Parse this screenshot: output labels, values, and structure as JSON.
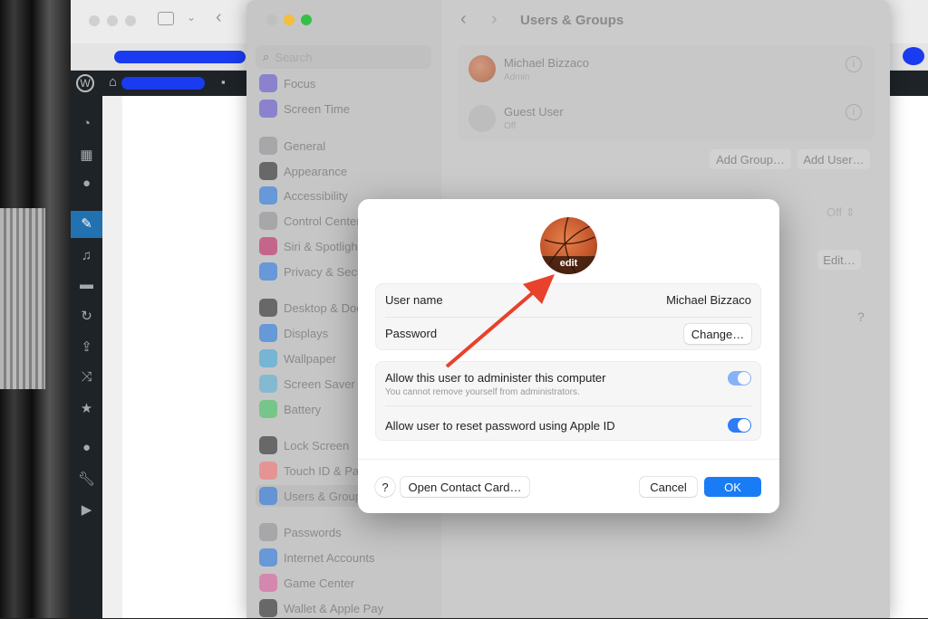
{
  "browser": {
    "accent": "#2271b1"
  },
  "settings": {
    "search_placeholder": "Search",
    "title": "Users & Groups",
    "sidebar": [
      {
        "label": "Focus",
        "color": "#5b4bd6"
      },
      {
        "label": "Screen Time",
        "color": "#5b4bd6"
      },
      {
        "label": "General",
        "color": "#8e8e93"
      },
      {
        "label": "Appearance",
        "color": "#1c1c1e"
      },
      {
        "label": "Accessibility",
        "color": "#1a73e8"
      },
      {
        "label": "Control Center",
        "color": "#8e8e93"
      },
      {
        "label": "Siri & Spotlight",
        "color": "#c2185b"
      },
      {
        "label": "Privacy & Security",
        "color": "#1a73e8"
      },
      {
        "label": "Desktop & Dock",
        "color": "#1c1c1e"
      },
      {
        "label": "Displays",
        "color": "#1a73e8"
      },
      {
        "label": "Wallpaper",
        "color": "#35a7e0"
      },
      {
        "label": "Screen Saver",
        "color": "#4fb0d8"
      },
      {
        "label": "Battery",
        "color": "#34c759"
      },
      {
        "label": "Lock Screen",
        "color": "#1c1c1e"
      },
      {
        "label": "Touch ID & Password",
        "color": "#ff6b6b"
      },
      {
        "label": "Users & Groups",
        "color": "#1a73e8",
        "selected": true
      },
      {
        "label": "Passwords",
        "color": "#8e8e93"
      },
      {
        "label": "Internet Accounts",
        "color": "#1a73e8"
      },
      {
        "label": "Game Center",
        "color": "#e0559a"
      },
      {
        "label": "Wallet & Apple Pay",
        "color": "#1c1c1e"
      }
    ],
    "users": [
      {
        "name": "Michael Bizzaco",
        "role": "Admin"
      },
      {
        "name": "Guest User",
        "role": "Off"
      }
    ],
    "add_group": "Add Group…",
    "add_user": "Add User…",
    "autologin_value": "Off",
    "edit": "Edit…",
    "help": "?"
  },
  "dialog": {
    "avatar_label": "edit",
    "username_label": "User name",
    "username_value": "Michael Bizzaco",
    "password_label": "Password",
    "change_button": "Change…",
    "admin_label": "Allow this user to administer this computer",
    "admin_note": "You cannot remove yourself from administrators.",
    "admin_on": true,
    "reset_label": "Allow user to reset password using Apple ID",
    "reset_on": true,
    "help": "?",
    "open_contact": "Open Contact Card…",
    "cancel": "Cancel",
    "ok": "OK",
    "accent": "#1a7cf5",
    "arrow_color": "#e8412c"
  }
}
